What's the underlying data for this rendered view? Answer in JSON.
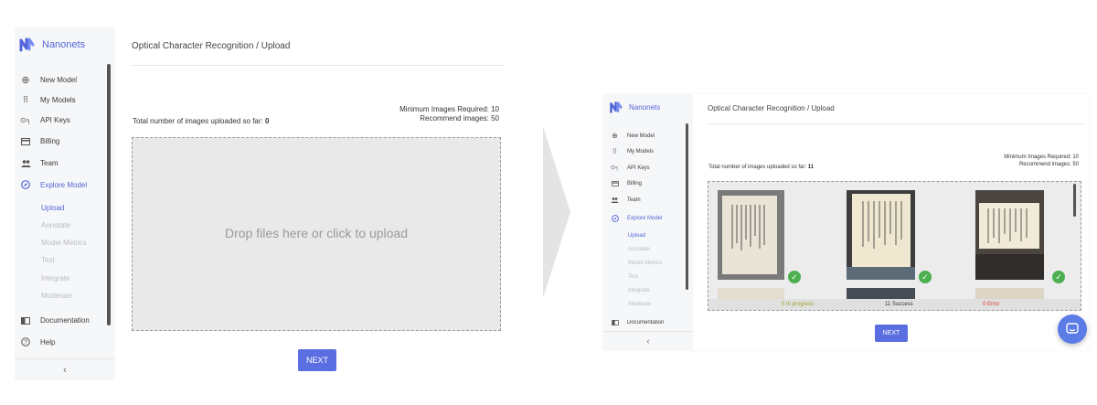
{
  "left": {
    "brand": "Nanonets",
    "nav": [
      {
        "label": "New Model",
        "icon": "plus-circle-icon"
      },
      {
        "label": "My Models",
        "icon": "grid-icon"
      },
      {
        "label": "API Keys",
        "icon": "key-icon"
      },
      {
        "label": "Billing",
        "icon": "card-icon"
      },
      {
        "label": "Team",
        "icon": "people-icon"
      },
      {
        "label": "Explore Model",
        "icon": "compass-icon"
      }
    ],
    "sub": [
      "Upload",
      "Annotate",
      "Model Metrics",
      "Test",
      "Integrate",
      "Moderate"
    ],
    "bottom_nav": [
      {
        "label": "Documentation",
        "icon": "book-icon"
      },
      {
        "label": "Help",
        "icon": "help-icon"
      }
    ],
    "collapse": "‹",
    "breadcrumb": "Optical Character Recognition / Upload",
    "total_label": "Total number of images uploaded so far:",
    "total_value": "0",
    "min_required": "Minimum Images Required: 10",
    "recommend": "Recommend images: 50",
    "drop_text": "Drop files here or click to upload",
    "next": "NEXT"
  },
  "right": {
    "brand": "Nanonets",
    "nav": [
      {
        "label": "New Model",
        "icon": "plus-circle-icon"
      },
      {
        "label": "My Models",
        "icon": "grid-icon"
      },
      {
        "label": "API Keys",
        "icon": "key-icon"
      },
      {
        "label": "Billing",
        "icon": "card-icon"
      },
      {
        "label": "Team",
        "icon": "people-icon"
      },
      {
        "label": "Explore Model",
        "icon": "compass-icon"
      }
    ],
    "sub": [
      "Upload",
      "Annotate",
      "Model Metrics",
      "Test",
      "Integrate",
      "Moderate"
    ],
    "doc": "Documentation",
    "collapse": "‹",
    "breadcrumb": "Optical Character Recognition / Upload",
    "total_label": "Total number of images uploaded so far:",
    "total_value": "11",
    "min_required": "Minimum Images Required: 10",
    "recommend": "Recommend images: 50",
    "status_progress": "0 In progress",
    "status_success": "11 Success",
    "status_error": "0 Error",
    "next": "NEXT"
  },
  "colors": {
    "accent": "#5465d8",
    "button": "#5b6ee1",
    "success": "#4caf50",
    "error": "#e53935",
    "progress": "#9e9d24"
  }
}
